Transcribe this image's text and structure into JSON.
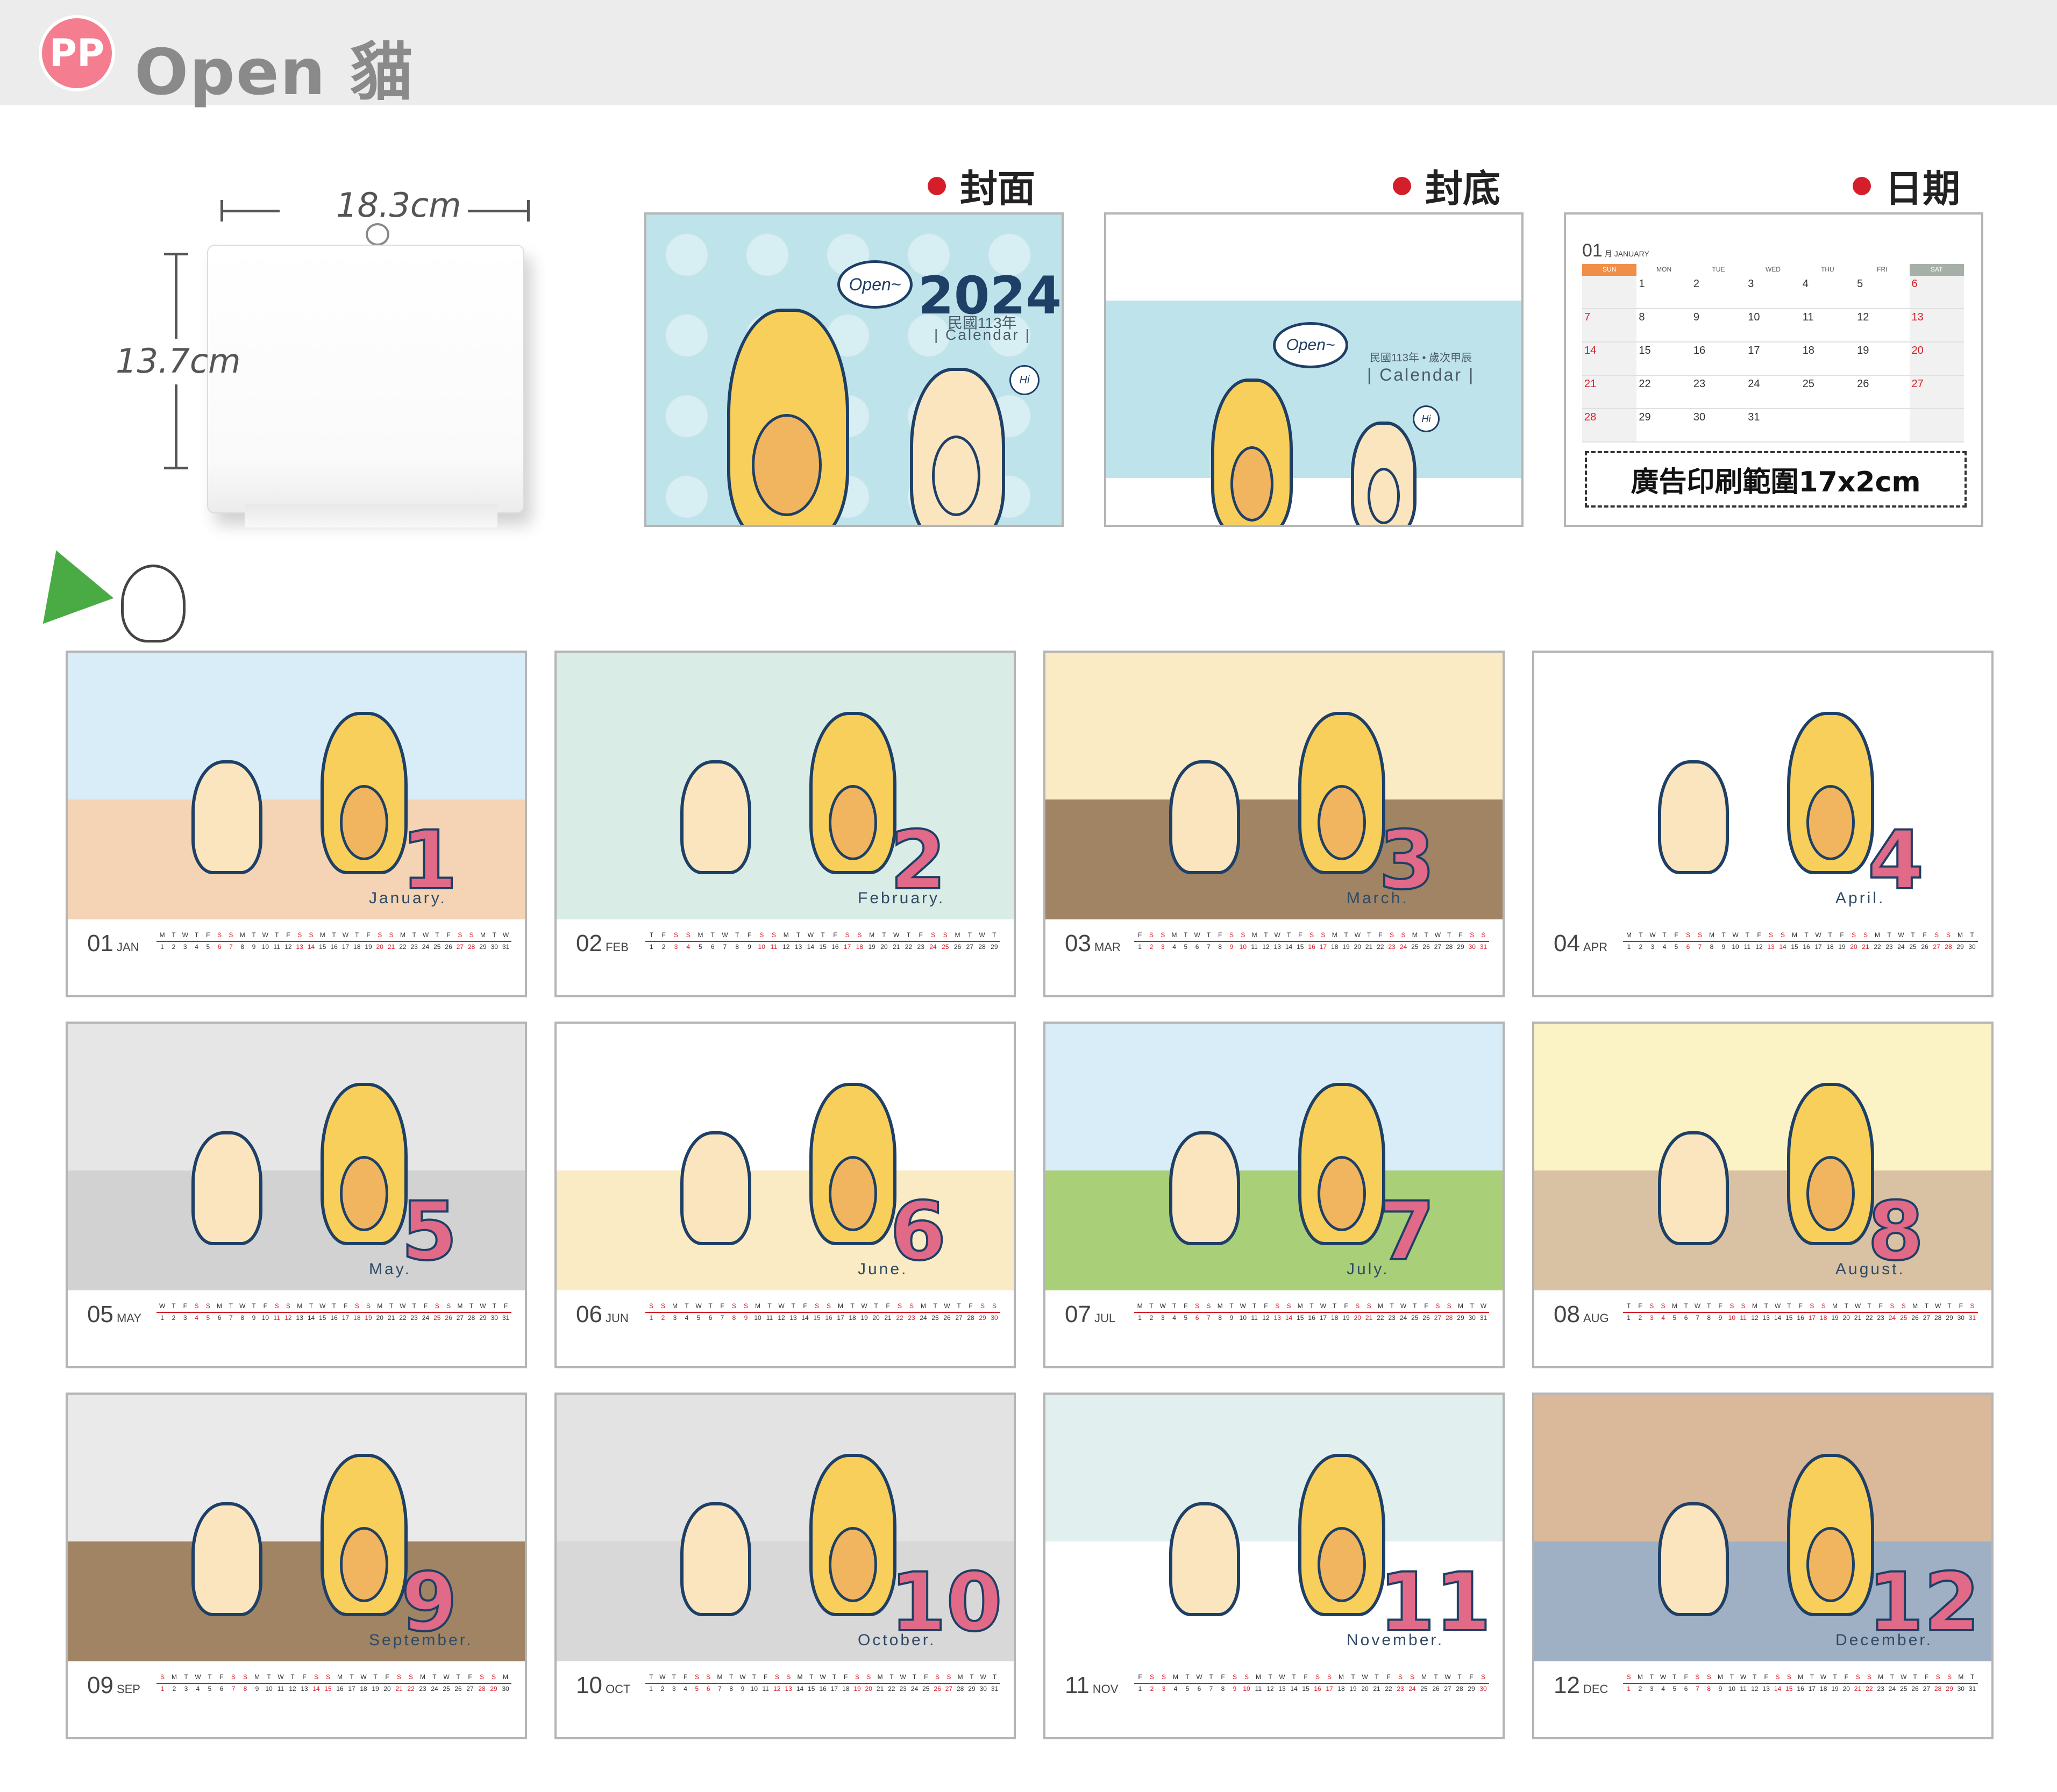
{
  "header": {
    "badge": "PP",
    "brand": "Open 貓"
  },
  "dimensions": {
    "width_label": "18.3cm",
    "height_label": "13.7cm"
  },
  "previews": {
    "cover": {
      "label": "封面",
      "bubble": "Open~",
      "year": "2024",
      "sub1": "民國113年",
      "sub2": "| Calendar |",
      "hi": "Hi"
    },
    "back": {
      "label": "封底",
      "bubble": "Open~",
      "sub1": "民國113年 • 歲次甲辰",
      "sub2": "| Calendar |",
      "hi": "Hi"
    },
    "date": {
      "label": "日期",
      "month_num": "01",
      "month_name": "月 JANUARY",
      "weekdays": [
        "SUN",
        "MON",
        "TUE",
        "WED",
        "THU",
        "FRI",
        "SAT"
      ],
      "weeks": [
        [
          "",
          "1",
          "2",
          "3",
          "4",
          "5",
          "6"
        ],
        [
          "7",
          "8",
          "9",
          "10",
          "11",
          "12",
          "13"
        ],
        [
          "14",
          "15",
          "16",
          "17",
          "18",
          "19",
          "20"
        ],
        [
          "21",
          "22",
          "23",
          "24",
          "25",
          "26",
          "27"
        ],
        [
          "28",
          "29",
          "30",
          "31",
          "",
          "",
          ""
        ]
      ],
      "ad_text": "廣告印刷範圍17x2cm"
    }
  },
  "colors": {
    "accent_red": "#d41f2a",
    "navy": "#1e3f66",
    "cat_yellow": "#f7cf5a",
    "cat_cream": "#fbe5bf",
    "pink": "#f47d8f"
  },
  "months": [
    {
      "num": "01",
      "abbr": "JAN",
      "big": "1",
      "word": "January.",
      "wd": "MTWTFSSMTWTFSSMTWTFSSMTWTFSSMTW",
      "days": 31,
      "first": 1,
      "sky": "#d8edf7",
      "ground": "#f4d4b4"
    },
    {
      "num": "02",
      "abbr": "FEB",
      "big": "2",
      "word": "February.",
      "wd": "TFSSMTWTFSSMTWTFSSMTWTFSSMTWT",
      "days": 29,
      "first": 4,
      "sky": "#d9ede6",
      "ground": "#d9ede6"
    },
    {
      "num": "03",
      "abbr": "MAR",
      "big": "3",
      "word": "March.",
      "wd": "FSSMTWTFSSMTWTFSSMTWTFSSMTWTFSS",
      "days": 31,
      "first": 5,
      "sky": "#fbebc5",
      "ground": "#a08464"
    },
    {
      "num": "04",
      "abbr": "APR",
      "big": "4",
      "word": "April.",
      "wd": "MTWTFSSMTWTFSSMTWTFSSMTWTFSSMT",
      "days": 30,
      "first": 1,
      "sky": "#ffffff",
      "ground": "#ffffff"
    },
    {
      "num": "05",
      "abbr": "MAY",
      "big": "5",
      "word": "May.",
      "wd": "WTFSSMTWTFSSMTWTFSSMTWTFSSMTWTF",
      "days": 31,
      "first": 3,
      "sky": "#e6e6e6",
      "ground": "#d2d2d2"
    },
    {
      "num": "06",
      "abbr": "JUN",
      "big": "6",
      "word": "June.",
      "wd": "SSMTWTFSSMTWTFSSMTWTFSSMTWTFSS",
      "days": 30,
      "first": 6,
      "sky": "#ffffff",
      "ground": "#fbebc5"
    },
    {
      "num": "07",
      "abbr": "JUL",
      "big": "7",
      "word": "July.",
      "wd": "MTWTFSSMTWTFSSMTWTFSSMTWTFSSMTW",
      "days": 31,
      "first": 1,
      "sky": "#d8edf7",
      "ground": "#a9cf79"
    },
    {
      "num": "08",
      "abbr": "AUG",
      "big": "8",
      "word": "August.",
      "wd": "TFSSMTWTFSSMTWTFSSMTWTFSSMTWTFS",
      "days": 31,
      "first": 4,
      "sky": "#fbf3c5",
      "ground": "#d9c1a3"
    },
    {
      "num": "09",
      "abbr": "SEP",
      "big": "9",
      "word": "September.",
      "wd": "SMTWTFSSMTWTFSSMTWTFSSMTWTFSSM",
      "days": 30,
      "first": 7,
      "sky": "#eaeaea",
      "ground": "#a08464"
    },
    {
      "num": "10",
      "abbr": "OCT",
      "big": "10",
      "word": "October.",
      "wd": "TWTFSSMTWTFSSMTWTFSSMTWTFSSMTWT",
      "days": 31,
      "first": 2,
      "sky": "#e3e3e3",
      "ground": "#d8d8d8"
    },
    {
      "num": "11",
      "abbr": "NOV",
      "big": "11",
      "word": "November.",
      "wd": "FSSMTWTFSSMTWTFSSMTWTFSSMTWTFS",
      "days": 30,
      "first": 5,
      "sky": "#e1f0ee",
      "ground": "#ffffff"
    },
    {
      "num": "12",
      "abbr": "DEC",
      "big": "12",
      "word": "December.",
      "wd": "SMTWTFSSMTWTFSSMTWTFSSMTWTFSSMT",
      "days": 31,
      "first": 7,
      "sky": "#d9b99a",
      "ground": "#9fb0c4"
    }
  ]
}
